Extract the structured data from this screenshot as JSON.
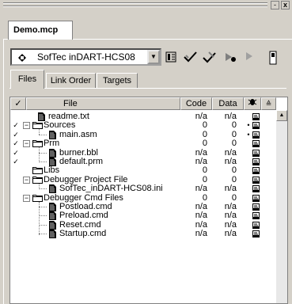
{
  "window": {
    "minimize_glyph": "-",
    "close_glyph": "x"
  },
  "document_tab": {
    "label": "Demo.mcp"
  },
  "target": {
    "selected": "SofTec inDART-HCS08"
  },
  "toolbar": {
    "icons": [
      "settings-icon",
      "check-syntax-icon",
      "compile-icon",
      "make-icon",
      "debug-icon",
      "run-icon"
    ]
  },
  "tabs": [
    {
      "label": "Files",
      "active": true
    },
    {
      "label": "Link Order",
      "active": false
    },
    {
      "label": "Targets",
      "active": false
    }
  ],
  "columns": {
    "check": "",
    "file": "File",
    "code": "Code",
    "data": "Data",
    "debug": ""
  },
  "rows": [
    {
      "check": "",
      "expander": "",
      "type": "file",
      "name": "readme.txt",
      "code": "n/a",
      "data": "n/a",
      "dot": "",
      "level": 0
    },
    {
      "check": "✓",
      "expander": "−",
      "type": "folder",
      "name": "Sources",
      "code": "0",
      "data": "0",
      "dot": "•",
      "level": 0
    },
    {
      "check": "✓",
      "expander": "",
      "type": "file",
      "name": "main.asm",
      "code": "0",
      "data": "0",
      "dot": "•",
      "level": 1
    },
    {
      "check": "✓",
      "expander": "−",
      "type": "folder",
      "name": "Prm",
      "code": "0",
      "data": "0",
      "dot": "",
      "level": 0
    },
    {
      "check": "✓",
      "expander": "",
      "type": "file",
      "name": "burner.bbl",
      "code": "n/a",
      "data": "n/a",
      "dot": "",
      "level": 1
    },
    {
      "check": "✓",
      "expander": "",
      "type": "file",
      "name": "default.prm",
      "code": "n/a",
      "data": "n/a",
      "dot": "",
      "level": 1
    },
    {
      "check": "",
      "expander": "",
      "type": "folder",
      "name": "Libs",
      "code": "0",
      "data": "0",
      "dot": "",
      "level": 0
    },
    {
      "check": "",
      "expander": "−",
      "type": "folder",
      "name": "Debugger Project File",
      "code": "0",
      "data": "0",
      "dot": "",
      "level": 0
    },
    {
      "check": "",
      "expander": "",
      "type": "file",
      "name": "SofTec_inDART-HCS08.ini",
      "code": "n/a",
      "data": "n/a",
      "dot": "",
      "level": 1
    },
    {
      "check": "",
      "expander": "−",
      "type": "folder",
      "name": "Debugger Cmd Files",
      "code": "0",
      "data": "0",
      "dot": "",
      "level": 0
    },
    {
      "check": "",
      "expander": "",
      "type": "file",
      "name": "Postload.cmd",
      "code": "n/a",
      "data": "n/a",
      "dot": "",
      "level": 1
    },
    {
      "check": "",
      "expander": "",
      "type": "file",
      "name": "Preload.cmd",
      "code": "n/a",
      "data": "n/a",
      "dot": "",
      "level": 1
    },
    {
      "check": "",
      "expander": "",
      "type": "file",
      "name": "Reset.cmd",
      "code": "n/a",
      "data": "n/a",
      "dot": "",
      "level": 1
    },
    {
      "check": "",
      "expander": "",
      "type": "file",
      "name": "Startup.cmd",
      "code": "n/a",
      "data": "n/a",
      "dot": "",
      "level": 1
    }
  ]
}
